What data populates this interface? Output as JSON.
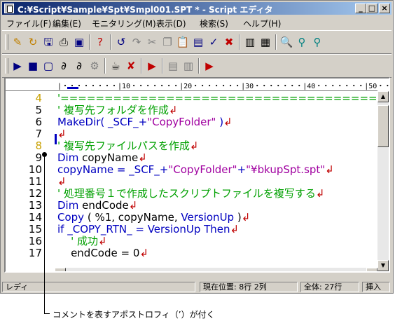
{
  "window": {
    "title": "C:¥Script¥Sample¥Spt¥Smpl001.SPT * - Script エディタ"
  },
  "window_controls": {
    "minimize": "_",
    "maximize": "□",
    "close": "×"
  },
  "menu": [
    "ファイル(F)",
    "編集(E)",
    "モニタリング(M)",
    "表示(D)",
    "検索(S)",
    "ヘルプ(H)"
  ],
  "toolbar1": [
    {
      "icon": "new-file-icon",
      "glyph": "✎",
      "color": "#c08000"
    },
    {
      "icon": "open-file-icon",
      "glyph": "↻",
      "color": "#c08000"
    },
    {
      "icon": "save-icon",
      "glyph": "🖫",
      "color": "#000080"
    },
    {
      "icon": "print-icon",
      "glyph": "⎙",
      "color": "#000000"
    },
    {
      "icon": "properties-icon",
      "glyph": "▣",
      "color": "#000080"
    },
    {
      "icon": "help-icon",
      "glyph": "?",
      "color": "#c00000"
    },
    {
      "icon": "undo-icon",
      "glyph": "↺",
      "color": "#000080"
    },
    {
      "icon": "redo-icon",
      "glyph": "↷",
      "color": "#808080"
    },
    {
      "icon": "cut-icon",
      "glyph": "✂",
      "color": "#808080"
    },
    {
      "icon": "copy-icon",
      "glyph": "❐",
      "color": "#808080"
    },
    {
      "icon": "paste-icon",
      "glyph": "📋",
      "color": "#808080"
    },
    {
      "icon": "insert-icon",
      "glyph": "▤",
      "color": "#000080"
    },
    {
      "icon": "check-icon",
      "glyph": "✓",
      "color": "#000080"
    },
    {
      "icon": "stop-icon",
      "glyph": "✖",
      "color": "#c00000"
    },
    {
      "icon": "compare-icon",
      "glyph": "▥",
      "color": "#000000"
    },
    {
      "icon": "layout-icon",
      "glyph": "▦",
      "color": "#000000"
    },
    {
      "icon": "find-icon",
      "glyph": "🔍",
      "color": "#000080"
    },
    {
      "icon": "find-next-icon",
      "glyph": "⚲",
      "color": "#008080"
    },
    {
      "icon": "find-prev-icon",
      "glyph": "⚲",
      "color": "#008080"
    }
  ],
  "toolbar2": [
    {
      "icon": "run-icon",
      "glyph": "▶",
      "color": "#000080"
    },
    {
      "icon": "monitor-icon",
      "glyph": "■",
      "color": "#000080"
    },
    {
      "icon": "window-icon",
      "glyph": "▢",
      "color": "#000080"
    },
    {
      "icon": "step-icon",
      "glyph": "∂",
      "color": "#000000"
    },
    {
      "icon": "step-over-icon",
      "glyph": "∂",
      "color": "#000000"
    },
    {
      "icon": "step-out-icon",
      "glyph": "⚙",
      "color": "#808080"
    },
    {
      "icon": "breakpoint-icon",
      "glyph": "☕",
      "color": "#000000"
    },
    {
      "icon": "clear-breakpoint-icon",
      "glyph": "✘",
      "color": "#c00000"
    },
    {
      "icon": "trace-icon",
      "glyph": "▶",
      "color": "#c00000"
    },
    {
      "icon": "variables-icon",
      "glyph": "▤",
      "color": "#808080"
    },
    {
      "icon": "watch-icon",
      "glyph": "▥",
      "color": "#808080"
    },
    {
      "icon": "log-icon",
      "glyph": "▶",
      "color": "#c00000"
    }
  ],
  "ruler": "|・・・・・・・・|10・・・・・・・|20・・・・・・・|30・・・・・・・|40・・・・・・・|50・・・",
  "lines": [
    {
      "num": "4",
      "parts": [
        {
          "t": "'=======================================",
          "c": "green"
        }
      ]
    },
    {
      "num": "5",
      "parts": [
        {
          "t": "' 複写先フォルダを作成",
          "c": "green"
        },
        {
          "t": "↲",
          "c": "red"
        }
      ]
    },
    {
      "num": "6",
      "parts": [
        {
          "t": "MakeDir( _SCF_+",
          "c": "blue"
        },
        {
          "t": "\"CopyFolder\"",
          "c": "purple"
        },
        {
          "t": " )",
          "c": "blue"
        },
        {
          "t": "↲",
          "c": "red"
        }
      ]
    },
    {
      "num": "7",
      "parts": [
        {
          "t": "↲",
          "c": "red"
        }
      ]
    },
    {
      "num": "8",
      "parts": [
        {
          "t": "' 複写先ファイルパスを作成",
          "c": "green"
        },
        {
          "t": "↲",
          "c": "red"
        }
      ]
    },
    {
      "num": "9",
      "parts": [
        {
          "t": "Dim",
          "c": "blue"
        },
        {
          "t": " copyName",
          "c": "black"
        },
        {
          "t": "↲",
          "c": "red"
        }
      ]
    },
    {
      "num": "10",
      "parts": [
        {
          "t": "copyName = _SCF_+",
          "c": "blue"
        },
        {
          "t": "\"CopyFolder\"",
          "c": "purple"
        },
        {
          "t": "+",
          "c": "blue"
        },
        {
          "t": "\"¥bkupSpt.spt\"",
          "c": "purple"
        },
        {
          "t": "↲",
          "c": "red"
        }
      ]
    },
    {
      "num": "11",
      "parts": [
        {
          "t": "↲",
          "c": "red"
        }
      ]
    },
    {
      "num": "12",
      "parts": [
        {
          "t": "' 処理番号１で作成したスクリプトファイルを複写する",
          "c": "green"
        },
        {
          "t": "↲",
          "c": "red"
        }
      ]
    },
    {
      "num": "13",
      "parts": [
        {
          "t": "Dim",
          "c": "blue"
        },
        {
          "t": " endCode",
          "c": "black"
        },
        {
          "t": "↲",
          "c": "red"
        }
      ]
    },
    {
      "num": "14",
      "parts": [
        {
          "t": "Copy",
          "c": "blue"
        },
        {
          "t": " ( %1, copyName, ",
          "c": "black"
        },
        {
          "t": "VersionUp",
          "c": "blue"
        },
        {
          "t": " )",
          "c": "black"
        },
        {
          "t": "↲",
          "c": "red"
        }
      ]
    },
    {
      "num": "15",
      "parts": [
        {
          "t": "if _COPY_RTN_ = VersionUp Then",
          "c": "blue"
        },
        {
          "t": "↲",
          "c": "red"
        }
      ]
    },
    {
      "num": "16",
      "parts": [
        {
          "t": "    ' 成功",
          "c": "green"
        },
        {
          "t": "↲",
          "c": "red"
        }
      ]
    },
    {
      "num": "17",
      "parts": [
        {
          "t": "    endCode = 0",
          "c": "black"
        },
        {
          "t": "↲",
          "c": "red"
        }
      ]
    }
  ],
  "status": {
    "ready": "レディ",
    "position": "現在位置:     8行 2列",
    "total": "全体:   27行",
    "mode": "挿入"
  },
  "caption": "コメントを表すアポストロフィ（’）が付く"
}
